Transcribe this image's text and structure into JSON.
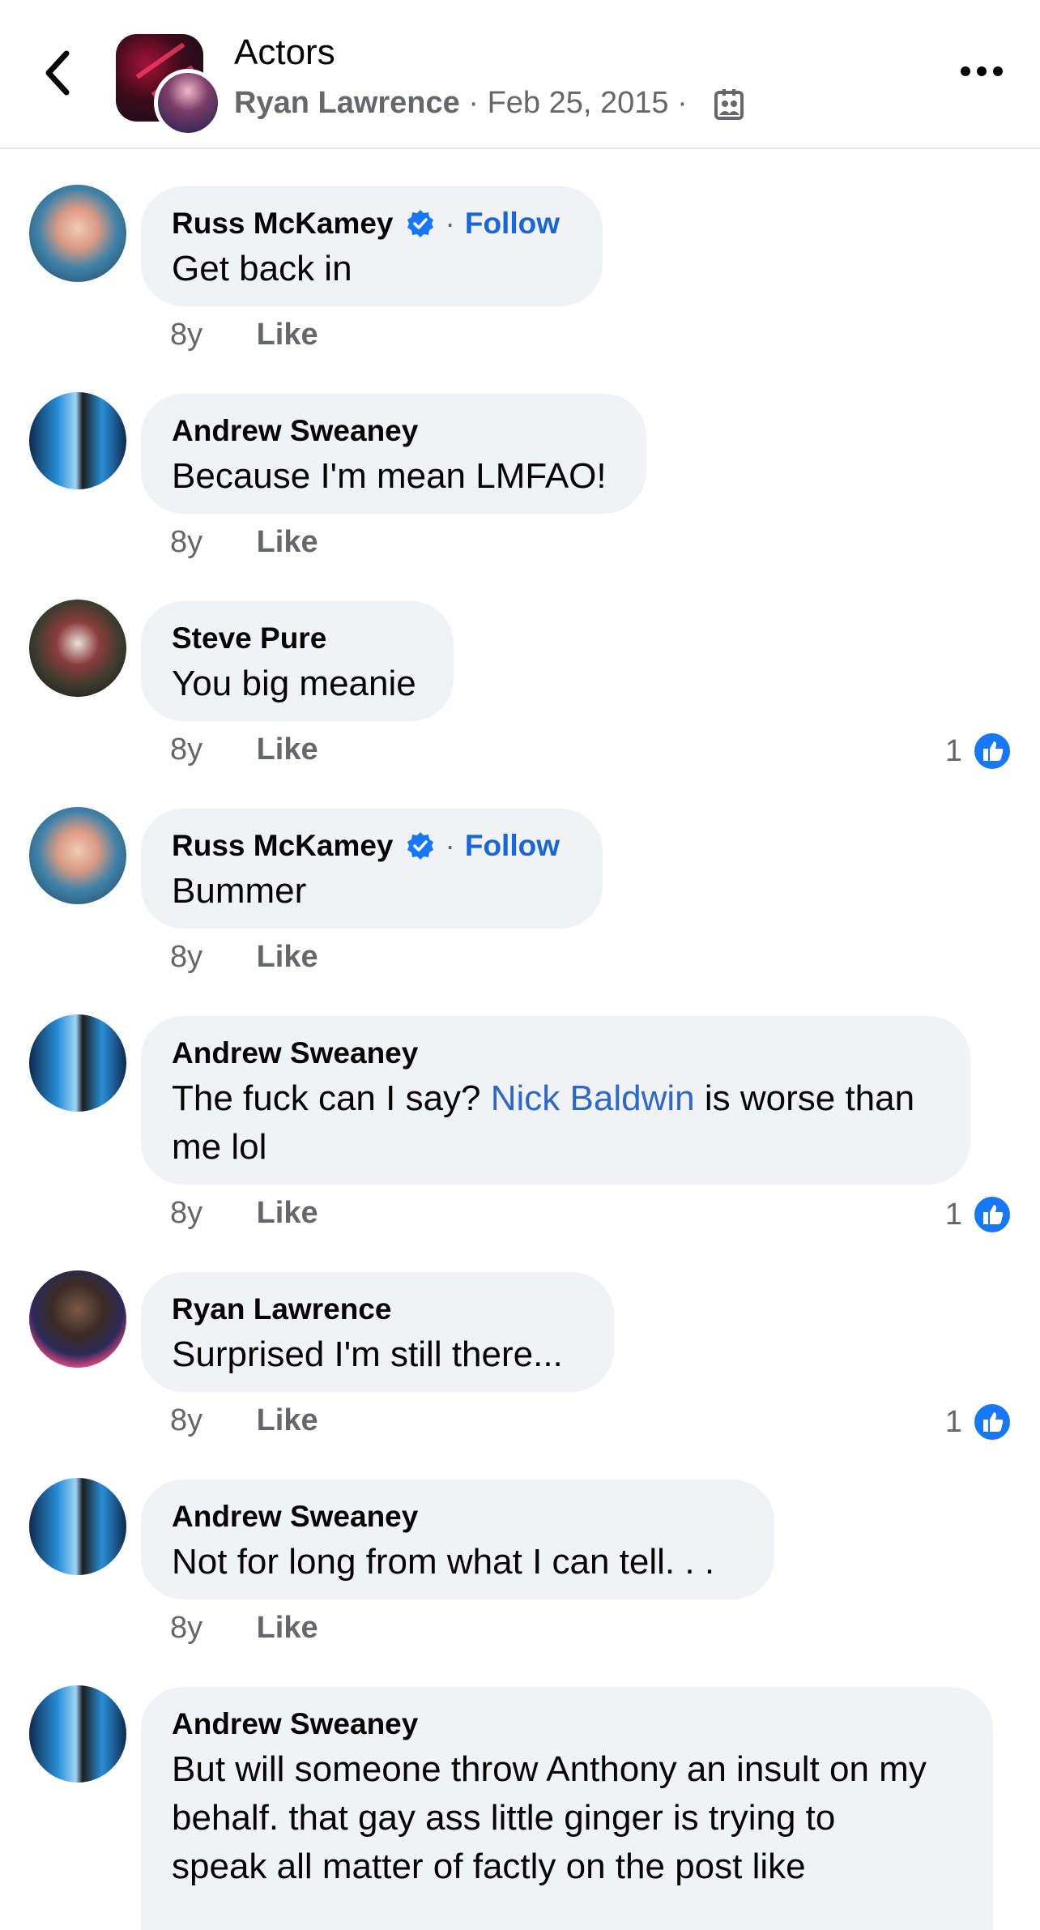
{
  "header": {
    "title": "Actors",
    "author": "Ryan Lawrence",
    "separator": "·",
    "date": "Feb 25, 2015",
    "back_icon": "chevron-left-icon",
    "privacy_icon": "group-members-icon",
    "more_icon": "more-horizontal-icon"
  },
  "colors": {
    "link_blue": "#1a66d2",
    "bubble_bg": "#f0f2f5",
    "secondary_text": "#65676b",
    "like_blue": "#1877f2"
  },
  "comments": [
    {
      "author": "Russ McKamey",
      "verified": true,
      "follow_label": "Follow",
      "text": "Get back in",
      "time": "8y",
      "like_label": "Like"
    },
    {
      "author": "Andrew Sweaney",
      "text": "Because I'm mean LMFAO!",
      "time": "8y",
      "like_label": "Like"
    },
    {
      "author": "Steve Pure",
      "text": "You big meanie",
      "time": "8y",
      "like_label": "Like",
      "reaction_count": "1"
    },
    {
      "author": "Russ McKamey",
      "verified": true,
      "follow_label": "Follow",
      "text": "Bummer",
      "time": "8y",
      "like_label": "Like"
    },
    {
      "author": "Andrew Sweaney",
      "text_before": "The fuck can I say? ",
      "mention": "Nick Baldwin",
      "text_after_line1": " is worse than",
      "text_line2": "me lol",
      "time": "8y",
      "like_label": "Like",
      "reaction_count": "1"
    },
    {
      "author": "Ryan Lawrence",
      "text": "Surprised I'm still there...",
      "time": "8y",
      "like_label": "Like",
      "reaction_count": "1"
    },
    {
      "author": "Andrew Sweaney",
      "text": "Not for long from what I can tell. . .",
      "time": "8y",
      "like_label": "Like"
    },
    {
      "author": "Andrew Sweaney",
      "text_line1": "But will someone throw Anthony an insult on my",
      "text_line2": "behalf. that gay ass little ginger is trying to",
      "text_line3": "speak all matter of factly on the post like"
    }
  ]
}
